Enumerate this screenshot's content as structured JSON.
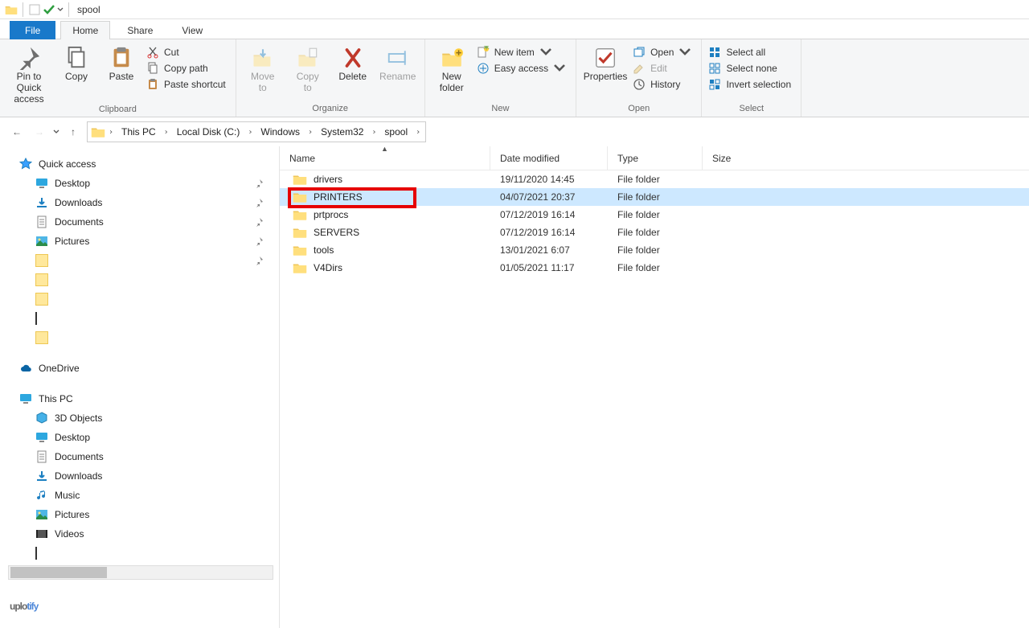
{
  "window": {
    "title": "spool"
  },
  "tabs": {
    "file": "File",
    "home": "Home",
    "share": "Share",
    "view": "View"
  },
  "ribbon": {
    "clipboard": {
      "label": "Clipboard",
      "pin": "Pin to Quick\naccess",
      "copy": "Copy",
      "paste": "Paste",
      "cut": "Cut",
      "copy_path": "Copy path",
      "paste_shortcut": "Paste shortcut"
    },
    "organize": {
      "label": "Organize",
      "move": "Move\nto",
      "copy": "Copy\nto",
      "delete": "Delete",
      "rename": "Rename"
    },
    "new": {
      "label": "New",
      "new_folder": "New\nfolder",
      "new_item": "New item",
      "easy_access": "Easy access"
    },
    "open": {
      "label": "Open",
      "properties": "Properties",
      "open": "Open",
      "edit": "Edit",
      "history": "History"
    },
    "select": {
      "label": "Select",
      "select_all": "Select all",
      "select_none": "Select none",
      "invert": "Invert selection"
    }
  },
  "breadcrumb": [
    "This PC",
    "Local Disk (C:)",
    "Windows",
    "System32",
    "spool"
  ],
  "nav": {
    "quick_access": "Quick access",
    "desktop": "Desktop",
    "downloads": "Downloads",
    "documents": "Documents",
    "pictures": "Pictures",
    "onedrive": "OneDrive",
    "this_pc": "This PC",
    "objects3d": "3D Objects",
    "pc_desktop": "Desktop",
    "pc_documents": "Documents",
    "pc_downloads": "Downloads",
    "pc_music": "Music",
    "pc_pictures": "Pictures",
    "pc_videos": "Videos"
  },
  "columns": {
    "name": "Name",
    "date": "Date modified",
    "type": "Type",
    "size": "Size"
  },
  "rows": [
    {
      "name": "drivers",
      "date": "19/11/2020 14:45",
      "type": "File folder",
      "size": ""
    },
    {
      "name": "PRINTERS",
      "date": "04/07/2021 20:37",
      "type": "File folder",
      "size": ""
    },
    {
      "name": "prtprocs",
      "date": "07/12/2019 16:14",
      "type": "File folder",
      "size": ""
    },
    {
      "name": "SERVERS",
      "date": "07/12/2019 16:14",
      "type": "File folder",
      "size": ""
    },
    {
      "name": "tools",
      "date": "13/01/2021 6:07",
      "type": "File folder",
      "size": ""
    },
    {
      "name": "V4Dirs",
      "date": "01/05/2021 11:17",
      "type": "File folder",
      "size": ""
    }
  ],
  "watermark": {
    "a": "uplo",
    "b": "tify"
  }
}
